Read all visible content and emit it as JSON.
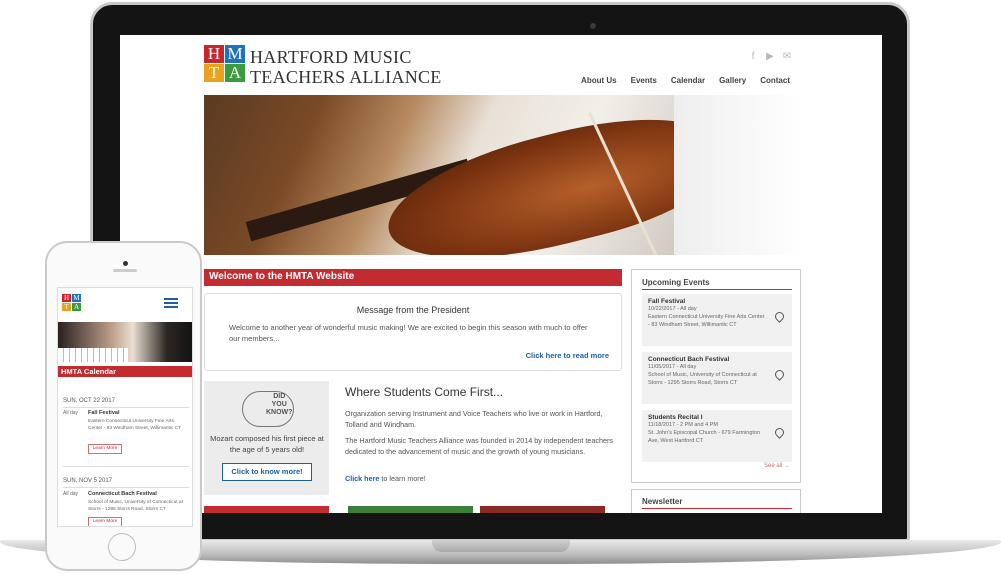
{
  "site": {
    "logo_letters": [
      "H",
      "M",
      "T",
      "A"
    ],
    "org_name_line1": "HARTFORD MUSIC",
    "org_name_line2": "TEACHERS ALLIANCE",
    "social_icons": [
      "facebook-icon",
      "youtube-icon",
      "email-icon"
    ],
    "nav": [
      "About Us",
      "Events",
      "Calendar",
      "Gallery",
      "Contact"
    ]
  },
  "welcome": {
    "banner": "Welcome to the HMTA Website",
    "president_title": "Message from the President",
    "president_text": "Welcome to another year of wonderful music making! We are excited to begin this season with much to offer our members...",
    "president_link": "Click here to read more"
  },
  "did_you_know": {
    "word1": "DID",
    "word2": "YOU",
    "word3": "KNOW?",
    "fact": "Mozart composed his first piece at the age of 5 years old!",
    "button": "Click to know more!"
  },
  "students_first": {
    "title": "Where Students Come First...",
    "p1": "Organization serving Instrument and Voice Teachers who live or work in Hartford, Tolland and Windham.",
    "p2": "The Hartford Music Teachers Alliance was founded in 2014 by independent teachers dedicated to the advancement of music and the growth of young musicians.",
    "link_bold": "Click here",
    "link_rest": " to learn more!"
  },
  "upcoming": {
    "title": "Upcoming Events",
    "events": [
      {
        "name": "Fall Festival",
        "when": "10/22/2017 - All day",
        "where": "Eastern Connecticut University Fine Arts Center - 83 Windham Street, Willimantic CT"
      },
      {
        "name": "Connecticut Bach Festival",
        "when": "11/05/2017 - All day",
        "where": "School of Music, University of Connecticut at Storrs - 1295 Storrs Road, Storrs CT"
      },
      {
        "name": "Students Recital I",
        "when": "11/18/2017 - 2 PM and 4 PM",
        "where": "St. John's Episcopal Church - 679 Farmington Ave, West Hartford CT"
      }
    ],
    "see_all": "See all →"
  },
  "newsletter": {
    "title": "Newsletter"
  },
  "phone": {
    "calendar_title": "HMTA Calendar",
    "items": [
      {
        "date": "SUN, OCT 22 2017",
        "allday": "All day",
        "name": "Fall Festival",
        "meta": "Eastern Connecticut University Fine Arts Center - 83 Windham Street, Willimantic CT",
        "button": "Learn More"
      },
      {
        "date": "SUN, NOV 5 2017",
        "allday": "All day",
        "name": "Connecticut Bach Festival",
        "meta": "School of Music, University of Connecticut at Storrs - 1295 Storrs Road, Storrs CT",
        "button": "Learn More"
      }
    ]
  }
}
